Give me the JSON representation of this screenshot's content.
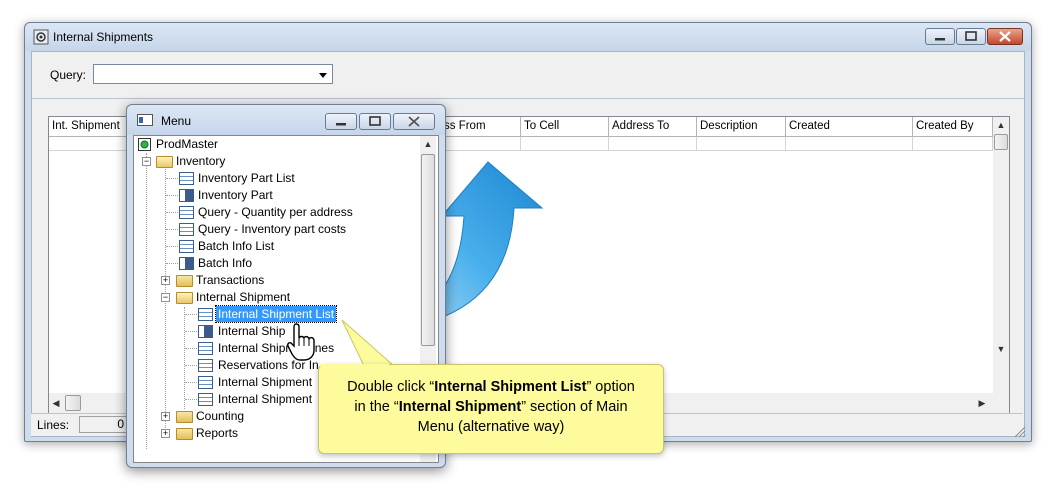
{
  "main_window": {
    "title": "Internal Shipments",
    "query_label": "Query:",
    "query_value": "",
    "columns": [
      "Int. Shipment",
      "",
      "ss From",
      "To Cell",
      "Address To",
      "Description",
      "Created",
      "Created By"
    ],
    "footer_lines_label": "Lines:",
    "footer_lines_value": "0"
  },
  "menu_window": {
    "title": "Menu",
    "items": [
      {
        "label": "ProdMaster",
        "kind": "root"
      },
      {
        "label": "Inventory",
        "kind": "folder-open"
      },
      {
        "label": "Inventory Part List",
        "kind": "list"
      },
      {
        "label": "Inventory Part",
        "kind": "form"
      },
      {
        "label": "Query - Quantity per address",
        "kind": "list"
      },
      {
        "label": "Query - Inventory part costs",
        "kind": "list"
      },
      {
        "label": "Batch Info List",
        "kind": "list"
      },
      {
        "label": "Batch Info",
        "kind": "form"
      },
      {
        "label": "Transactions",
        "kind": "folder-closed"
      },
      {
        "label": "Internal Shipment",
        "kind": "folder-open"
      },
      {
        "label": "Internal Shipment List",
        "kind": "list",
        "selected": true
      },
      {
        "label": "Internal Ship",
        "kind": "form"
      },
      {
        "label": "Internal Shipm  t Lines",
        "kind": "list"
      },
      {
        "label": "Reservations for In",
        "kind": "list"
      },
      {
        "label": "Internal Shipment",
        "kind": "list"
      },
      {
        "label": "Internal Shipment",
        "kind": "list"
      },
      {
        "label": "Counting",
        "kind": "folder-closed"
      },
      {
        "label": "Reports",
        "kind": "folder-closed"
      }
    ]
  },
  "callout": {
    "line1_pre": "Double click “",
    "line1_bold": "Internal Shipment List",
    "line1_post": "” option",
    "line2_pre": "in the “",
    "line2_bold": "Internal Shipment",
    "line2_post": "” section of Main",
    "line3": "Menu (alternative way)"
  },
  "colors": {
    "accent_arrow": "#2a9be0",
    "callout_bg": "#fdfb9c",
    "selection": "#3399ff"
  },
  "icons": [
    "app-icon",
    "minimize-icon",
    "maximize-icon",
    "close-icon",
    "chevron-down-icon",
    "hand-cursor-icon",
    "curved-arrow-icon",
    "folder-icon",
    "list-icon",
    "form-icon"
  ]
}
